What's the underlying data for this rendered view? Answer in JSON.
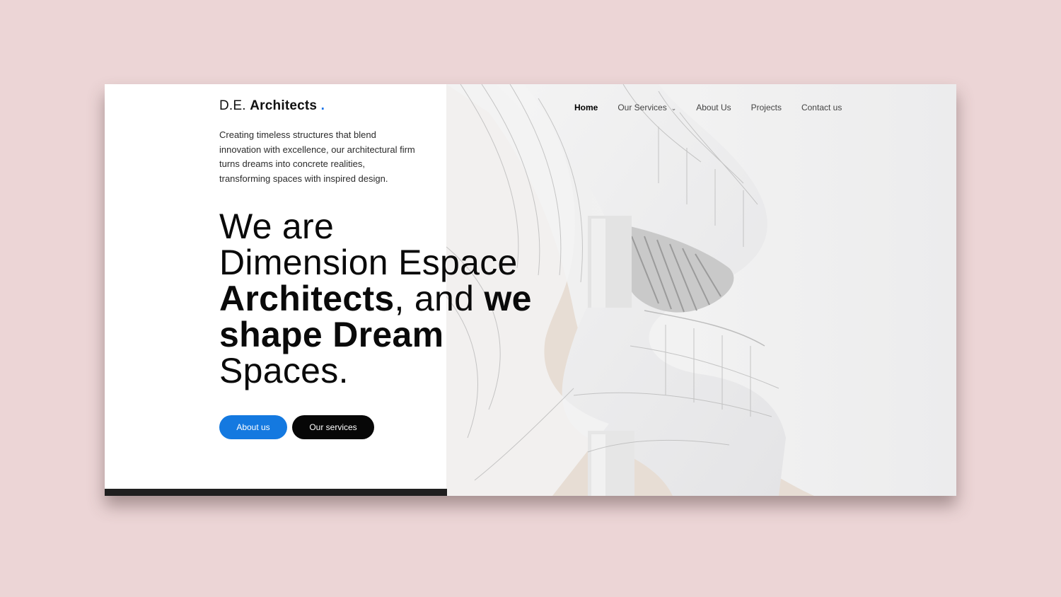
{
  "brand": {
    "name_light": "D.E.",
    "name_bold": "Architects",
    "dot": ".",
    "accent": "#1a73e8"
  },
  "intro": "Creating timeless structures that blend innovation with excellence, our architectural firm turns dreams into concrete realities, transforming spaces with inspired design.",
  "headline": {
    "line1": "We are",
    "line2": "Dimension Espace",
    "line3_bold": "Architects",
    "line3_rest": ", and ",
    "line3_bold2": "we",
    "line4_bold": "shape Dream",
    "line5": "Spaces."
  },
  "buttons": {
    "about": "About us",
    "services": "Our services"
  },
  "nav": {
    "items": [
      {
        "label": "Home",
        "active": true
      },
      {
        "label": "Our Services",
        "dropdown": true
      },
      {
        "label": "About Us"
      },
      {
        "label": "Projects"
      },
      {
        "label": "Contact us"
      }
    ],
    "dropdown_icon": "chevron-down-icon"
  },
  "colors": {
    "primary_button": "#1479e0",
    "secondary_button": "#070707",
    "background": "#ecd5d6"
  }
}
